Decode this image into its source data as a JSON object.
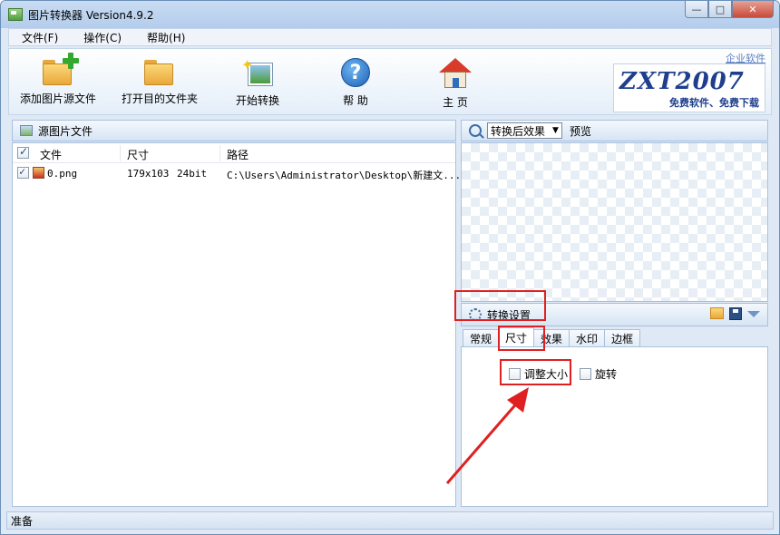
{
  "window": {
    "title": "图片转换器 Version4.9.2",
    "minimize": "—",
    "maximize": "□",
    "close": "✕"
  },
  "menu": {
    "items": [
      "文件(F)",
      "操作(C)",
      "帮助(H)"
    ]
  },
  "toolbar": {
    "add_source": "添加图片源文件",
    "open_target": "打开目的文件夹",
    "start_convert": "开始转换",
    "help": "帮 助",
    "home": "主 页",
    "help_glyph": "?",
    "star_glyph": "✦"
  },
  "brand": {
    "logo": "ZXT2007",
    "subtitle": "免费软件、免费下载",
    "link": "企业软件"
  },
  "source_panel": {
    "title": "源图片文件",
    "columns": [
      "文件",
      "尺寸",
      "路径"
    ],
    "rows": [
      {
        "checked": true,
        "file": "0.png",
        "size": "179x103",
        "depth": "24bit",
        "path": "C:\\Users\\Administrator\\Desktop\\新建文..."
      }
    ]
  },
  "preview_panel": {
    "mode": "转换后效果",
    "label": "预览"
  },
  "settings_panel": {
    "title": "转换设置",
    "tabs": [
      "常规",
      "尺寸",
      "效果",
      "水印",
      "边框"
    ],
    "active_tab": "尺寸",
    "options": {
      "resize": "调整大小",
      "rotate": "旋转",
      "resize_checked": false,
      "rotate_checked": false
    }
  },
  "status": {
    "text": "准备"
  },
  "colors": {
    "annotation": "#e02020",
    "accent": "#1f3f8e"
  }
}
